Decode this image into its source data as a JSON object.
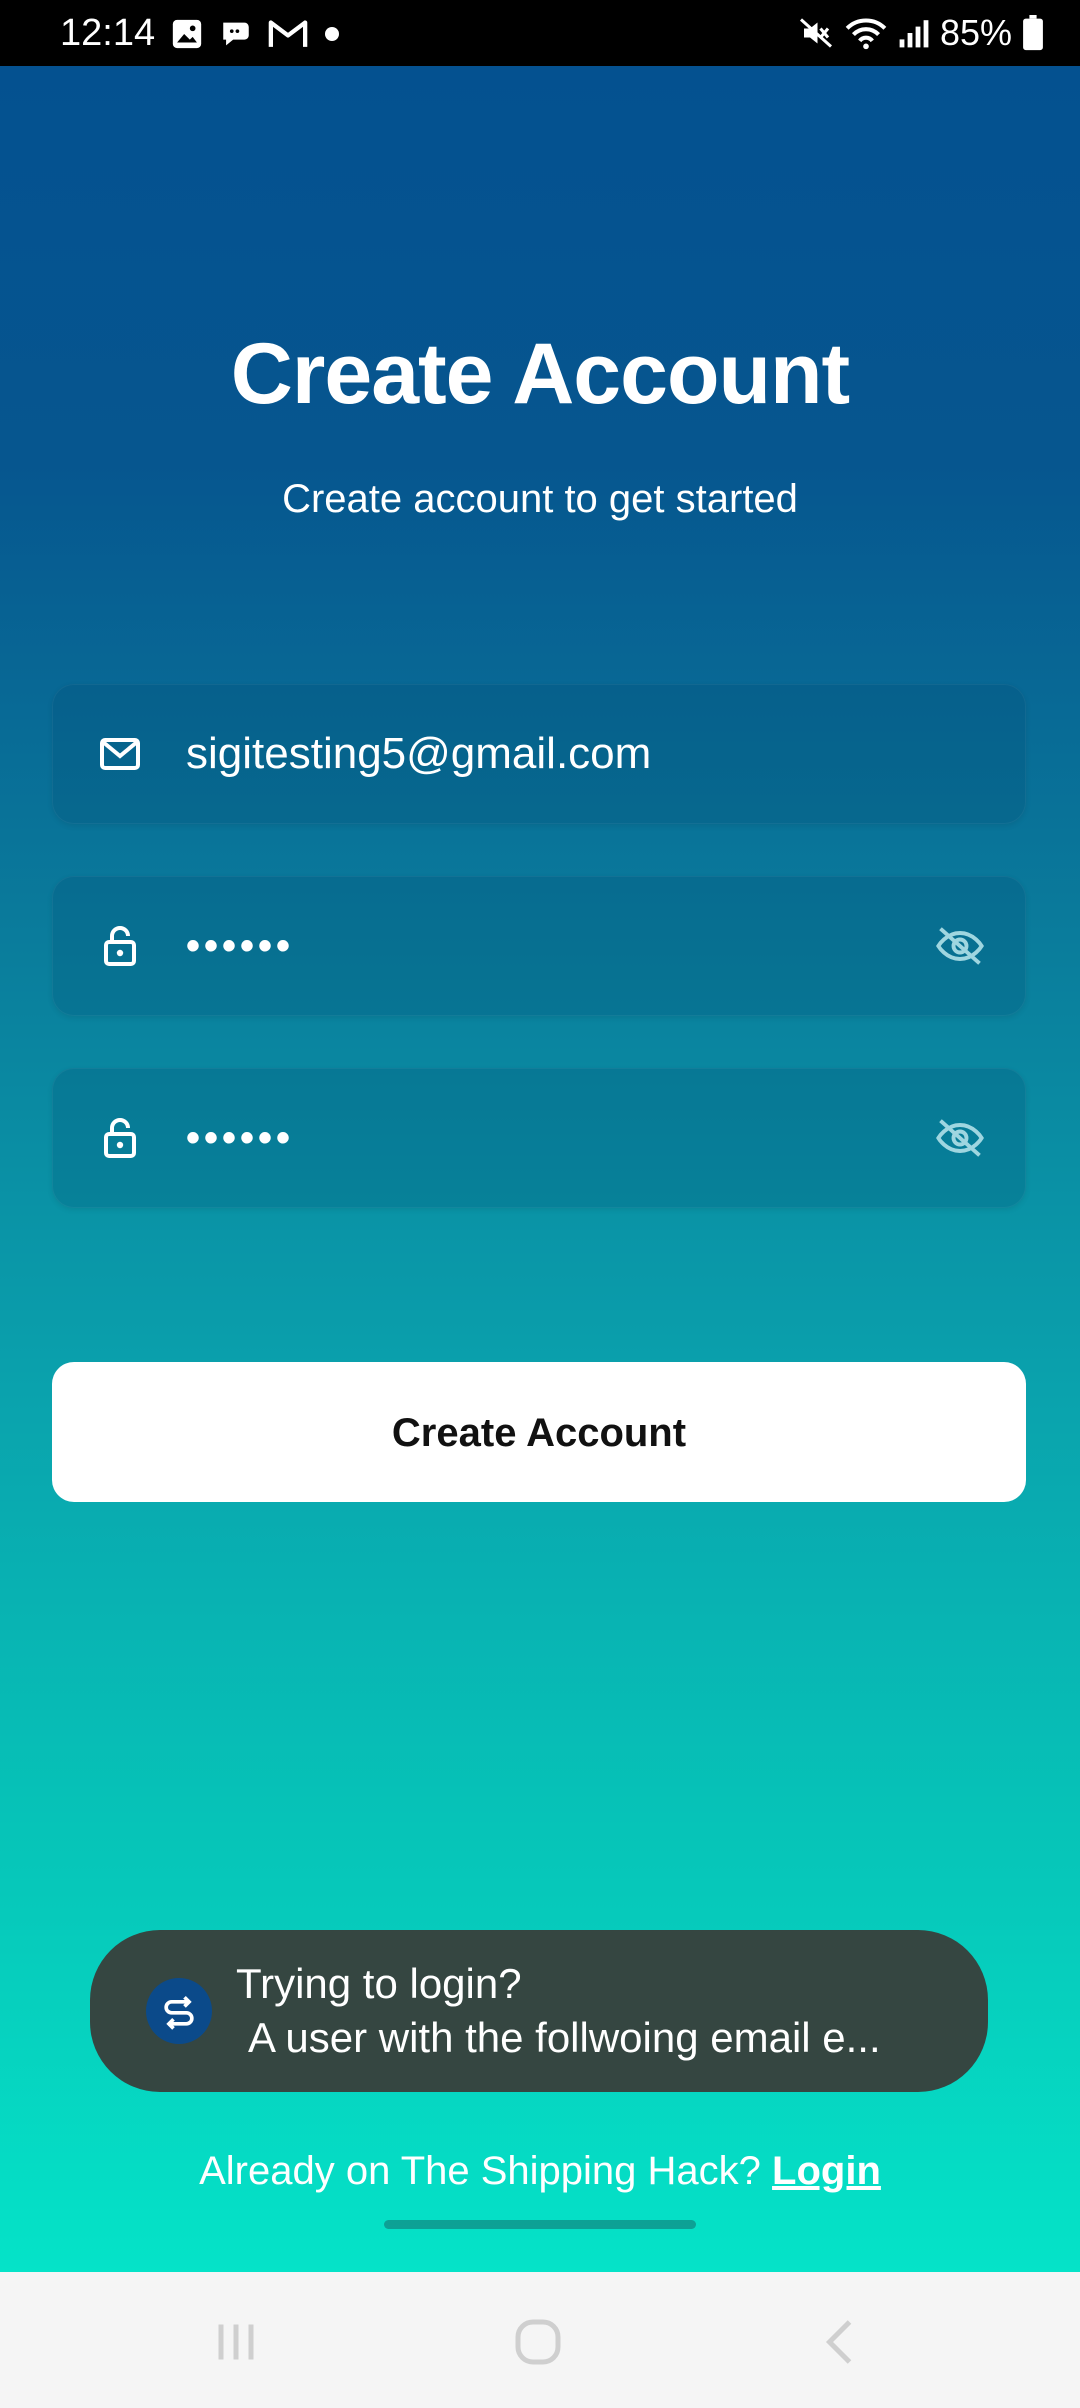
{
  "status_bar": {
    "time": "12:14",
    "battery": "85%",
    "notification_icons": [
      "gallery-icon",
      "chat-icon",
      "gmail-icon",
      "dot-icon"
    ],
    "system_icons": [
      "mute-icon",
      "wifi-icon",
      "signal-icon",
      "battery-icon"
    ]
  },
  "page": {
    "title": "Create Account",
    "subtitle": "Create account to get started"
  },
  "form": {
    "email": {
      "value": "sigitesting5@gmail.com",
      "icon": "mail-icon"
    },
    "password": {
      "value": "••••••",
      "icon": "lock-icon",
      "toggle_icon": "eye-off-icon"
    },
    "confirm_password": {
      "value": "••••••",
      "icon": "lock-icon",
      "toggle_icon": "eye-off-icon"
    },
    "submit_label": "Create Account"
  },
  "toast": {
    "line1": "Trying to login?",
    "line2": "A user with the follwoing email e..."
  },
  "footer": {
    "prompt": "Already on The Shipping Hack?",
    "link": "Login"
  },
  "colors": {
    "gradient_top": "#045190",
    "gradient_bottom": "#05e3c8",
    "toast_bg": "#354641",
    "button_bg": "#ffffff"
  }
}
